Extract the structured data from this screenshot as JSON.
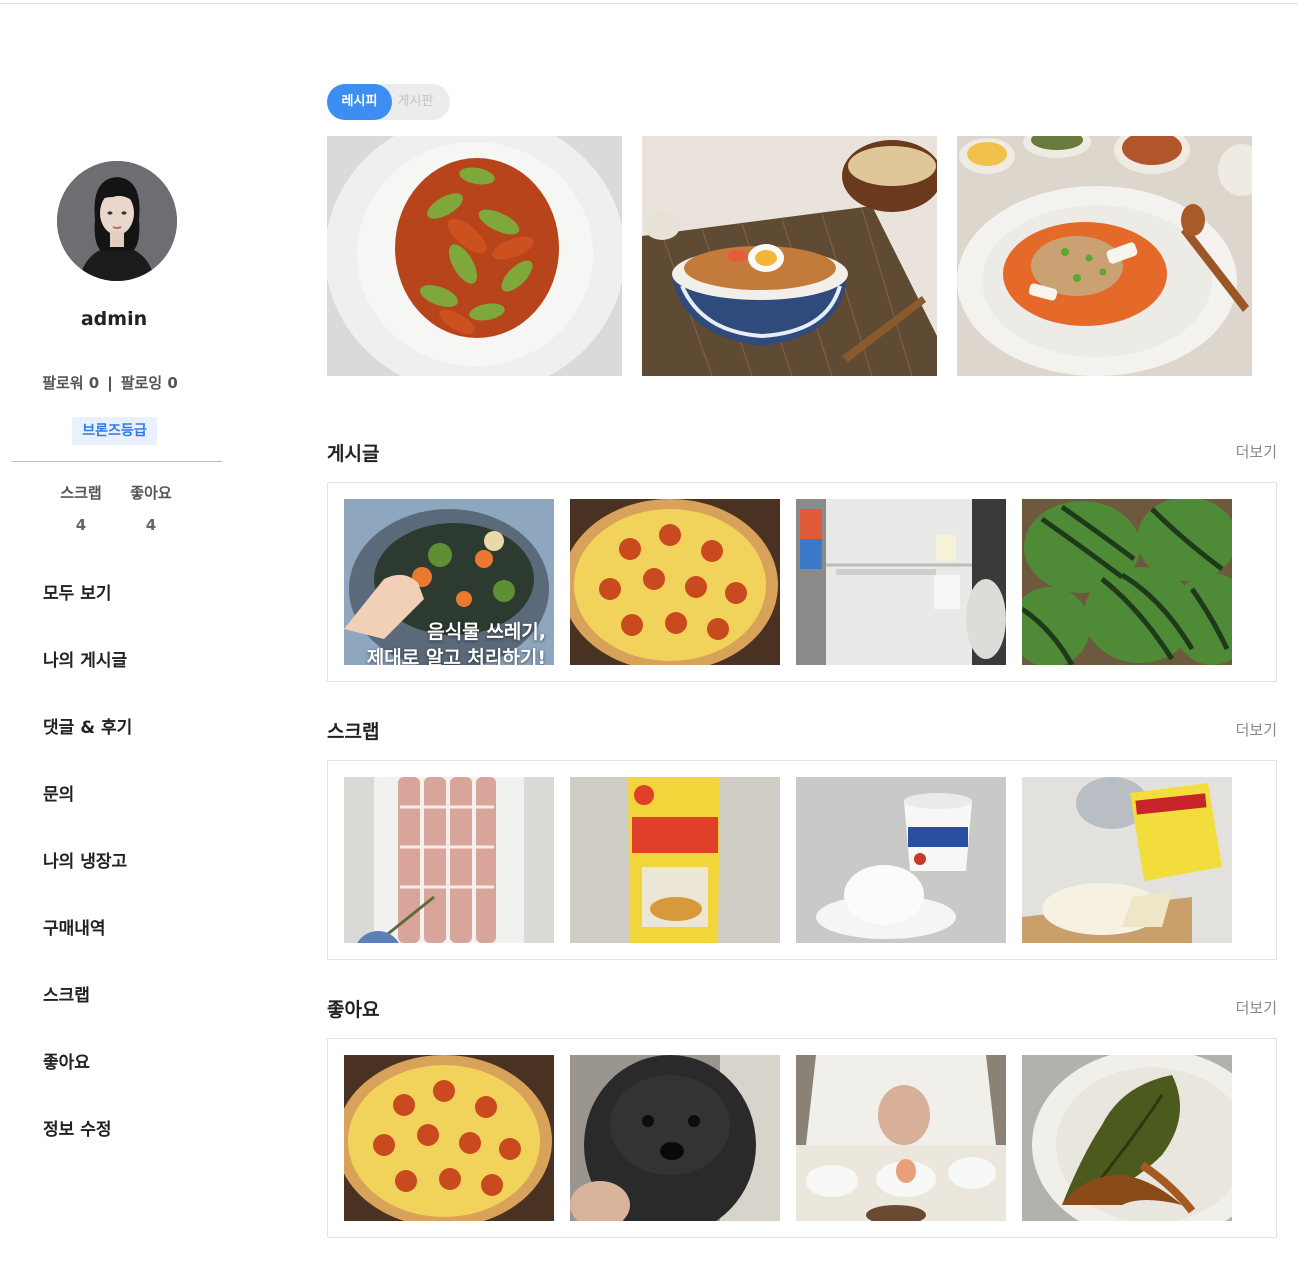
{
  "profile": {
    "username": "admin",
    "followers_label": "팔로워 0",
    "separator": "|",
    "following_label": "팔로잉 0",
    "grade": "브론즈등급",
    "stats": [
      {
        "label": "스크랩",
        "value": "4"
      },
      {
        "label": "좋아요",
        "value": "4"
      }
    ]
  },
  "menu": [
    {
      "label": "모두 보기"
    },
    {
      "label": "나의 게시글"
    },
    {
      "label": "댓글 & 후기"
    },
    {
      "label": "문의"
    },
    {
      "label": "나의 냉장고"
    },
    {
      "label": "구매내역"
    },
    {
      "label": "스크랩"
    },
    {
      "label": "좋아요"
    },
    {
      "label": "정보 수정"
    }
  ],
  "toggle": {
    "active": "레시피",
    "inactive": "게시판"
  },
  "sections": {
    "posts": {
      "title": "게시글",
      "more": "더보기",
      "first_overlay_line1": "음식물 쓰레기,",
      "first_overlay_line2": "제대로 알고 처리하기!"
    },
    "scrap": {
      "title": "스크랩",
      "more": "더보기"
    },
    "likes": {
      "title": "좋아요",
      "more": "더보기"
    }
  },
  "colors": {
    "accent": "#3d8ef2",
    "badge_bg": "#e8f1fd",
    "badge_text": "#2f7ce8"
  }
}
